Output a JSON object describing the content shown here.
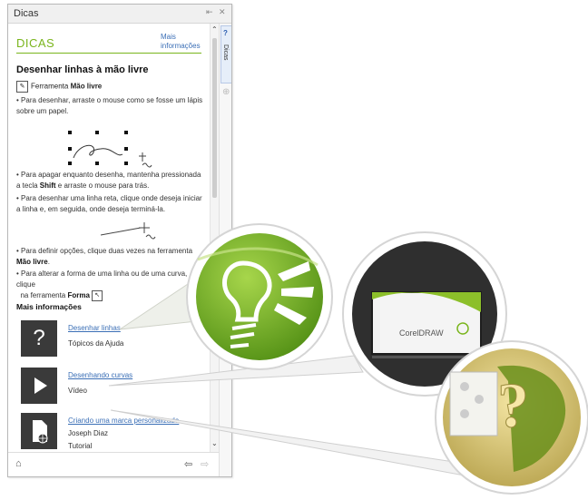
{
  "window": {
    "title": "Dicas",
    "pin_icon": "pin-icon",
    "close_icon": "close-icon"
  },
  "header": {
    "title": "DICAS",
    "more_link": "Mais informações"
  },
  "section": {
    "title": "Desenhar linhas à mão livre",
    "tool_prefix": "Ferramenta ",
    "tool_name": "Mão livre",
    "bullets": [
      {
        "text": "Para desenhar, arraste o mouse como se fosse um lápis sobre um papel."
      },
      {
        "a": "Para apagar enquanto desenha, mantenha pressionada a tecla ",
        "b": "Shift",
        "c": " e arraste o mouse para trás."
      },
      {
        "text": "Para desenhar uma linha reta, clique onde deseja iniciar a linha e, em seguida, onde deseja terminá-la."
      },
      {
        "a": "Para definir opções, clique duas vezes na ferramenta ",
        "b": "Mão livre",
        "c": "."
      },
      {
        "a": "Para alterar a forma de uma linha ou de uma curva, clique",
        "b2a": "na ferramenta ",
        "b": "Forma"
      }
    ]
  },
  "more_info": {
    "heading": "Mais informações",
    "items": [
      {
        "link": "Desenhar linhas",
        "meta1": "Tópicos da Ajuda",
        "icon": "help-question-icon"
      },
      {
        "link": "Desenhando curvas",
        "meta1": "Vídeo",
        "icon": "video-play-icon"
      },
      {
        "link": "Criando uma marca personalizada",
        "meta1": "Joseph Diaz",
        "meta2": "Tutorial",
        "icon": "web-document-icon"
      }
    ]
  },
  "side_tab": {
    "label": "Dicas"
  },
  "bottom": {
    "home_icon": "home-icon",
    "back_icon": "back-arrow-icon",
    "forward_icon": "forward-arrow-icon"
  },
  "video_thumb": {
    "brand": "CorelDRAW"
  },
  "colors": {
    "accent": "#7ab51d",
    "link": "#3b6fb6",
    "tile": "#3a3a3a"
  }
}
